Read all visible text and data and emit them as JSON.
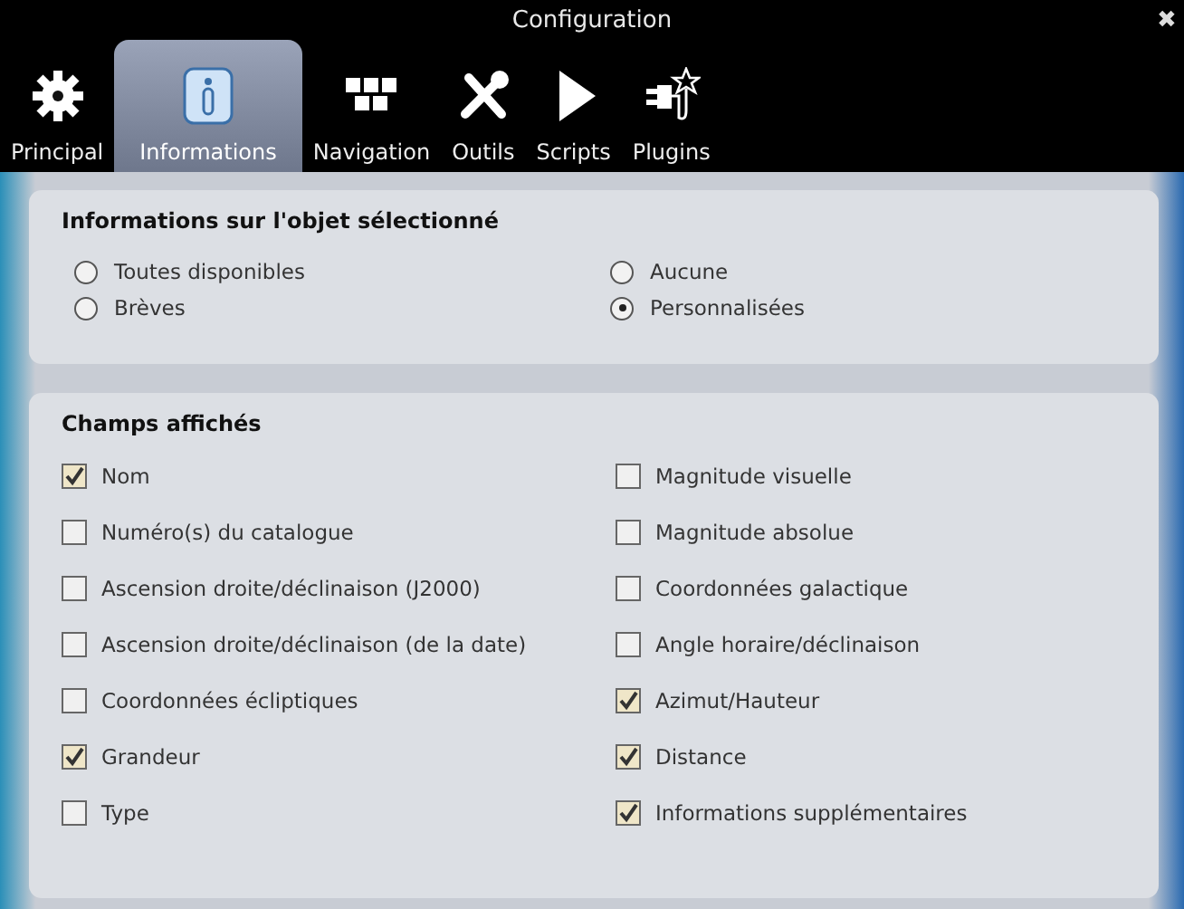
{
  "window": {
    "title": "Configuration",
    "close": "✖"
  },
  "tabs": [
    {
      "label": "Principal",
      "kind": "gear",
      "selected": false
    },
    {
      "label": "Informations",
      "kind": "info",
      "selected": true
    },
    {
      "label": "Navigation",
      "kind": "grid",
      "selected": false
    },
    {
      "label": "Outils",
      "kind": "tools",
      "selected": false
    },
    {
      "label": "Scripts",
      "kind": "play",
      "selected": false
    },
    {
      "label": "Plugins",
      "kind": "plug",
      "selected": false
    }
  ],
  "info_panel": {
    "title": "Informations sur l'objet sélectionné",
    "options": [
      {
        "label": "Toutes disponibles",
        "selected": false
      },
      {
        "label": "Aucune",
        "selected": false
      },
      {
        "label": "Brèves",
        "selected": false
      },
      {
        "label": "Personnalisées",
        "selected": true
      }
    ]
  },
  "fields_panel": {
    "title": "Champs affichés",
    "columns": [
      [
        {
          "label": "Nom",
          "checked": true
        },
        {
          "label": "Numéro(s) du catalogue",
          "checked": false
        },
        {
          "label": "Ascension droite/déclinaison (J2000)",
          "checked": false
        },
        {
          "label": "Ascension droite/déclinaison (de la date)",
          "checked": false
        },
        {
          "label": "Coordonnées écliptiques",
          "checked": false
        },
        {
          "label": "Grandeur",
          "checked": true
        },
        {
          "label": "Type",
          "checked": false
        }
      ],
      [
        {
          "label": "Magnitude visuelle",
          "checked": false
        },
        {
          "label": "Magnitude absolue",
          "checked": false
        },
        {
          "label": "Coordonnées galactique",
          "checked": false
        },
        {
          "label": "Angle horaire/déclinaison",
          "checked": false
        },
        {
          "label": "Azimut/Hauteur",
          "checked": true
        },
        {
          "label": "Distance",
          "checked": true
        },
        {
          "label": "Informations supplémentaires",
          "checked": true
        }
      ]
    ]
  }
}
